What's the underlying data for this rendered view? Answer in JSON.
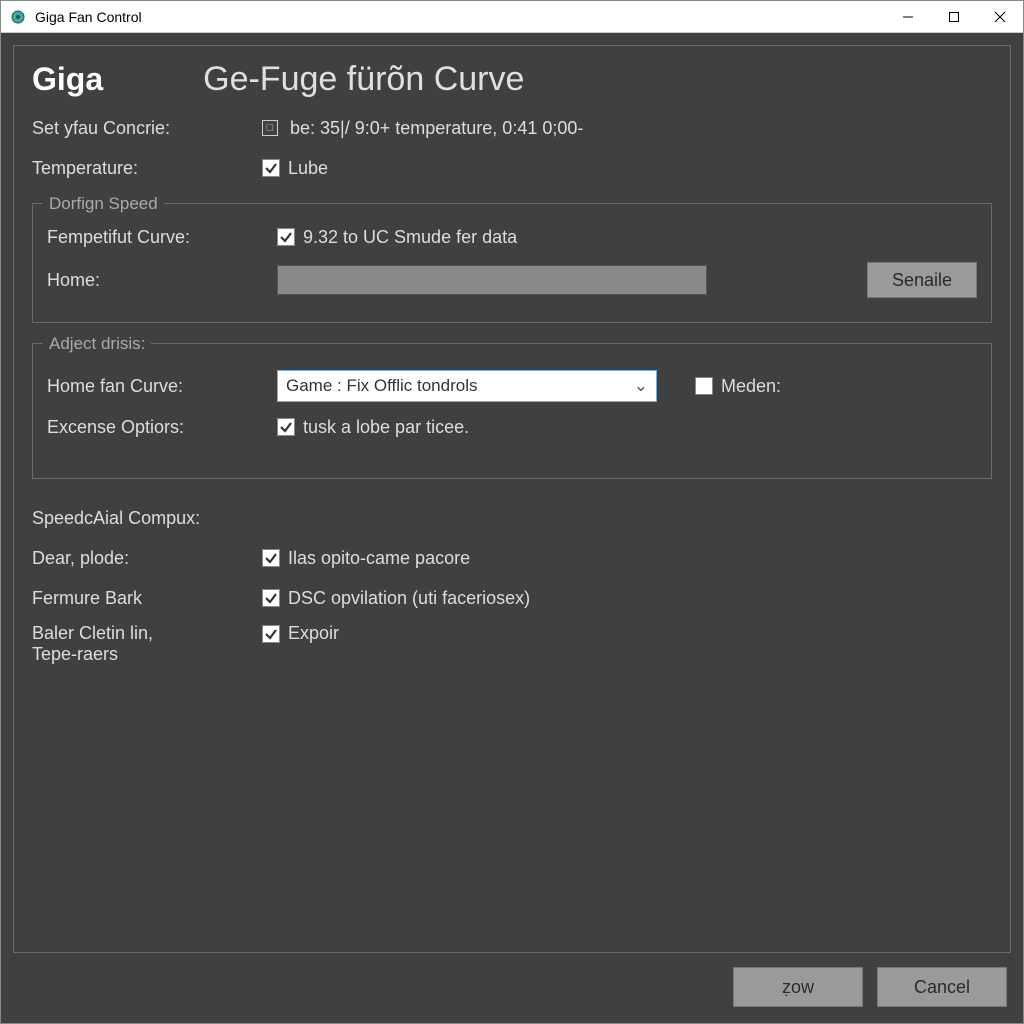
{
  "window": {
    "title": "Giga Fan Control"
  },
  "header": {
    "logo": "Giga",
    "title": "Ge-Fuge fürõn Curve"
  },
  "topRows": {
    "setConcrieLabel": "Set yfau Concrie:",
    "setConcrieValue": "be: 35|/ 9:0+ temperature, 0:41 0;00-",
    "temperatureLabel": "Temperature:",
    "temperatureCheckLabel": "Lube"
  },
  "group1": {
    "legend": "Dorfign Speed",
    "fempCurveLabel": "Fempetifut Curve:",
    "fempCurveCheckLabel": "9.32 to UC Smude fer data",
    "homeLabel": "Home:",
    "homeValue": "",
    "senaileBtn": "Senaile"
  },
  "group2": {
    "legend": "Adject drisis:",
    "homeFanLabel": "Home fan Curve:",
    "homeFanCombo": "Game : Fix Offlic tondrols",
    "medenLabel": "Meden:",
    "excenseLabel": "Excense Optiors:",
    "excenseCheckLabel": "tusk a lobe par ticee."
  },
  "bottom": {
    "speedLabel": "SpeedcAial Compux:",
    "dearLabel": "Dear, plode:",
    "dearCheckLabel": "Ilas opito-came pacore",
    "fermureLabel": "Fermure Bark",
    "fermureCheckLabel": "DSC opvilation (uti faceriosex)",
    "balerLabel1": "Baler Cletin lin,",
    "balerLabel2": "Tepe-raers",
    "balerCheckLabel": "Expoir"
  },
  "buttons": {
    "ok": "ẓow",
    "cancel": "Cancel"
  }
}
